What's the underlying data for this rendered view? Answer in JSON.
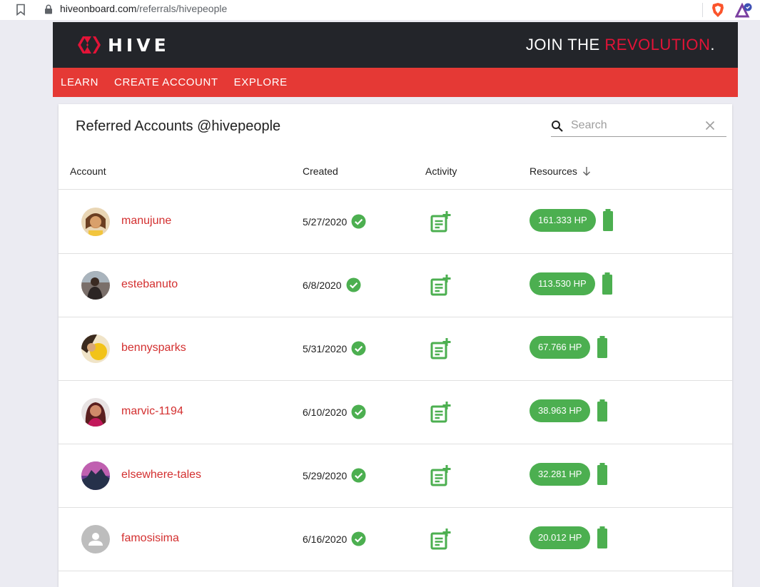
{
  "browser": {
    "url_domain": "hiveonboard.com",
    "url_path": "/referrals/hivepeople"
  },
  "site": {
    "logo_text": "HIVE",
    "tagline_prefix": "JOIN THE ",
    "tagline_highlight": "REVOLUTION",
    "tagline_suffix": ".",
    "nav": [
      "LEARN",
      "CREATE ACCOUNT",
      "EXPLORE"
    ],
    "colors": {
      "header_bg": "#23252a",
      "nav_bg": "#e53935",
      "brand_red": "#e31337",
      "hp_green": "#4caf50",
      "account_link": "#d32f2f"
    }
  },
  "card": {
    "title": "Referred Accounts @hivepeople",
    "search": {
      "placeholder": "Search",
      "value": ""
    },
    "columns": {
      "account": "Account",
      "created": "Created",
      "activity": "Activity",
      "resources": "Resources"
    },
    "sort_icon": "arrow-down-icon"
  },
  "accounts": [
    {
      "name": "manujune",
      "created": "5/27/2020",
      "hp": "161.333 HP"
    },
    {
      "name": "estebanuto",
      "created": "6/8/2020",
      "hp": "113.530 HP"
    },
    {
      "name": "bennysparks",
      "created": "5/31/2020",
      "hp": "67.766 HP"
    },
    {
      "name": "marvic-1194",
      "created": "6/10/2020",
      "hp": "38.963 HP"
    },
    {
      "name": "elsewhere-tales",
      "created": "5/29/2020",
      "hp": "32.281 HP"
    },
    {
      "name": "famosisima",
      "created": "6/16/2020",
      "hp": "20.012 HP"
    }
  ]
}
